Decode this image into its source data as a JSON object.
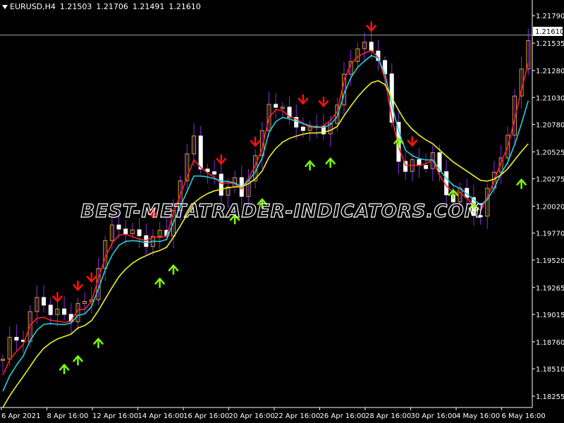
{
  "header": {
    "symbol": "EURUSD,H4",
    "open": "1.21503",
    "high": "1.21706",
    "low": "1.21491",
    "close": "1.21610"
  },
  "watermark": "BEST-METATRADER-INDICATORS.COM",
  "current_price_label": "1.21610",
  "colors": {
    "background": "#000000",
    "bull_candle": "#daa520",
    "bear_candle": "#ffffff",
    "wick": "#8a2be2",
    "fast_ma": "#ff2020",
    "mid_ma": "#20d0e0",
    "slow_ma": "#f0f020",
    "up_arrow": "#7cfc00",
    "down_arrow": "#ff1010",
    "axis": "#ffffff"
  },
  "chart_data": {
    "type": "candlestick",
    "symbol": "EURUSD",
    "timeframe": "H4",
    "y_ticks": [
      "1.21790",
      "1.21535",
      "1.21280",
      "1.21030",
      "1.20780",
      "1.20525",
      "1.20275",
      "1.20020",
      "1.19770",
      "1.19520",
      "1.19265",
      "1.19015",
      "1.18760",
      "1.18510",
      "1.18255"
    ],
    "ylim": [
      1.1815,
      1.2187
    ],
    "x_ticks": [
      "6 Apr 2021",
      "8 Apr 16:00",
      "12 Apr 16:00",
      "14 Apr 16:00",
      "16 Apr 16:00",
      "20 Apr 16:00",
      "22 Apr 16:00",
      "26 Apr 16:00",
      "28 Apr 16:00",
      "30 Apr 16:00",
      "4 May 16:00",
      "6 May 16:00"
    ],
    "current_price": 1.2161,
    "close_path": [
      1.186,
      1.188,
      1.1878,
      1.1905,
      1.1918,
      1.1905,
      1.19,
      1.1898,
      1.1915,
      1.1902,
      1.195,
      1.1975,
      1.1985,
      1.198,
      1.1972,
      1.197,
      1.1978,
      1.1968,
      1.201,
      1.2035,
      1.207,
      1.203,
      1.203,
      1.2015,
      1.2028,
      1.201,
      1.204,
      1.206,
      1.2105,
      1.2095,
      1.208,
      1.208,
      1.207,
      1.2075,
      1.2075,
      1.209,
      1.214,
      1.2145,
      1.215,
      1.215,
      1.212,
      1.206,
      1.2035,
      1.204,
      1.204,
      1.205,
      1.202,
      1.201,
      1.2015,
      1.2,
      1.1995,
      1.202,
      1.205,
      1.207,
      1.212,
      1.2161
    ],
    "series": [
      {
        "name": "",
        "type": "line",
        "color": "#ff2020",
        "values": [
          1.1845,
          1.1865,
          1.187,
          1.1895,
          1.19,
          1.1896,
          1.1895,
          1.1893,
          1.1908,
          1.1905,
          1.1935,
          1.1962,
          1.1975,
          1.1976,
          1.1972,
          1.197,
          1.1975,
          1.197,
          1.2,
          1.2022,
          1.2045,
          1.2035,
          1.203,
          1.2022,
          1.2025,
          1.2018,
          1.2032,
          1.205,
          1.209,
          1.2093,
          1.2085,
          1.2082,
          1.2075,
          1.2075,
          1.2078,
          1.209,
          1.213,
          1.214,
          1.2145,
          1.2148,
          1.212,
          1.207,
          1.204,
          1.204,
          1.204,
          1.2045,
          1.2025,
          1.2015,
          1.2015,
          1.2005,
          1.1998,
          1.2015,
          1.204,
          1.206,
          1.21,
          1.2135
        ]
      },
      {
        "name": "",
        "type": "line",
        "color": "#20d0e0",
        "values": [
          1.183,
          1.185,
          1.186,
          1.188,
          1.1892,
          1.1893,
          1.1892,
          1.1892,
          1.1902,
          1.1902,
          1.1925,
          1.195,
          1.1965,
          1.197,
          1.197,
          1.1968,
          1.197,
          1.1968,
          1.199,
          1.201,
          1.203,
          1.203,
          1.2028,
          1.2025,
          1.2025,
          1.202,
          1.2028,
          1.2042,
          1.2075,
          1.2085,
          1.2083,
          1.208,
          1.2077,
          1.2075,
          1.2075,
          1.2085,
          1.2115,
          1.213,
          1.2138,
          1.2145,
          1.2125,
          1.2085,
          1.2055,
          1.2048,
          1.2045,
          1.2045,
          1.2032,
          1.2022,
          1.2018,
          1.201,
          1.2003,
          1.201,
          1.203,
          1.2045,
          1.207,
          1.21
        ]
      },
      {
        "name": "",
        "type": "line",
        "color": "#f0f020",
        "values": [
          1.1815,
          1.183,
          1.1842,
          1.1855,
          1.1868,
          1.1875,
          1.188,
          1.1882,
          1.189,
          1.1892,
          1.1905,
          1.192,
          1.1935,
          1.1945,
          1.1952,
          1.1956,
          1.196,
          1.1962,
          1.1975,
          1.199,
          1.2005,
          1.2012,
          1.2016,
          1.2018,
          1.202,
          1.202,
          1.2024,
          1.2032,
          1.205,
          1.206,
          1.2065,
          1.2068,
          1.207,
          1.207,
          1.2071,
          1.2076,
          1.209,
          1.2102,
          1.2112,
          1.212,
          1.2115,
          1.2098,
          1.2082,
          1.2072,
          1.2065,
          1.206,
          1.2052,
          1.2044,
          1.2038,
          1.2032,
          1.2026,
          1.2025,
          1.203,
          1.2038,
          1.205,
          1.206
        ]
      }
    ],
    "up_arrows": [
      9,
      11,
      14,
      23,
      25,
      34,
      38,
      45,
      48,
      58,
      66,
      69,
      76
    ],
    "down_arrows": [
      8,
      11,
      13,
      22,
      32,
      37,
      44,
      47,
      54,
      60
    ]
  }
}
